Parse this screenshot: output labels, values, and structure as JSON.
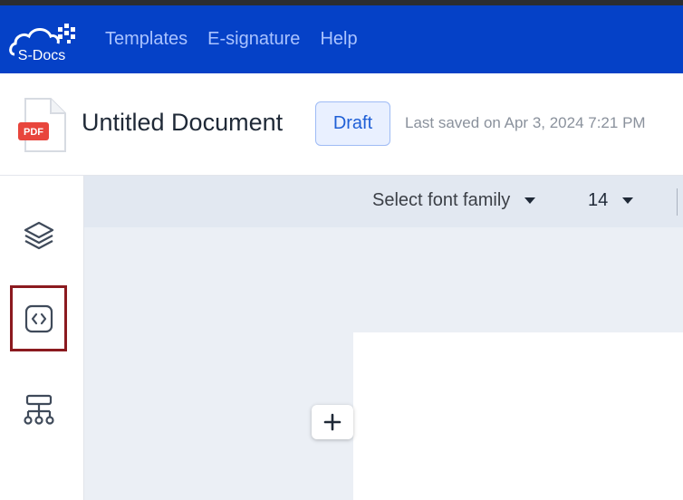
{
  "app": {
    "logo_text": "S-Docs",
    "brand_color": "#0541c7"
  },
  "nav": {
    "items": [
      {
        "label": "Templates"
      },
      {
        "label": "E-signature"
      },
      {
        "label": "Help"
      }
    ]
  },
  "document": {
    "file_icon_label": "PDF",
    "title": "Untitled Document",
    "status": "Draft",
    "last_saved": "Last saved on Apr 3, 2024 7:21 PM"
  },
  "sidebar": {
    "items": [
      {
        "icon": "layers-icon",
        "selected": false
      },
      {
        "icon": "code-icon",
        "selected": true,
        "highlight_color": "#8b1a1f"
      },
      {
        "icon": "hierarchy-icon",
        "selected": false
      }
    ]
  },
  "toolbar": {
    "font_family": "Select font family",
    "font_size": "14"
  },
  "canvas": {
    "add_icon": "plus-icon"
  }
}
